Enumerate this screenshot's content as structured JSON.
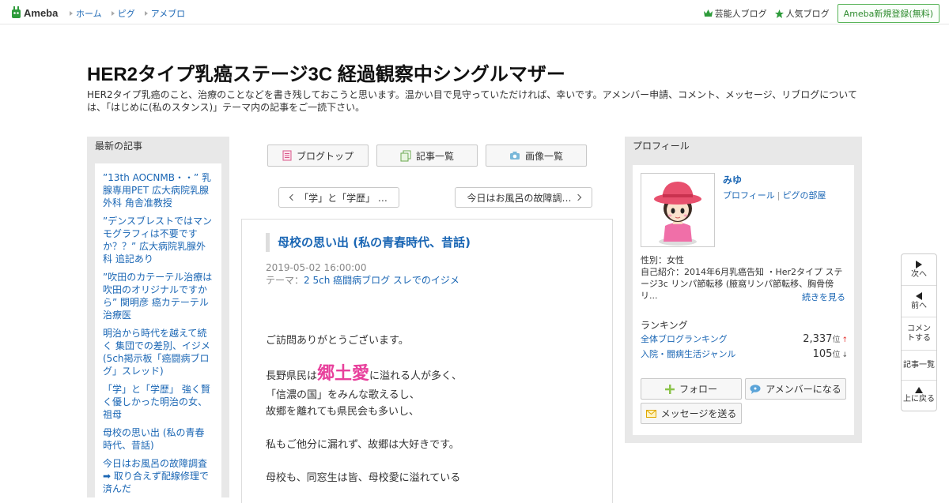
{
  "header": {
    "logo_text": "Ameba",
    "nav": [
      "ホーム",
      "ピグ",
      "アメブロ"
    ],
    "celebrity_blog": "芸能人ブログ",
    "popular_blog": "人気ブログ",
    "signup": "Ameba新規登録(無料)"
  },
  "blog": {
    "title": "HER2タイプ乳癌ステージ3C 経過観察中シングルマザー",
    "description": "HER2タイプ乳癌のこと、治療のことなどを書き残しておこうと思います。温かい目で見守っていただければ、幸いです。アメンバー申請、コメント、メッセージ、リブログについては、「はじめに(私のスタンス)」テーマ内の記事をご一読下さい。"
  },
  "left_sidebar": {
    "heading": "最新の記事",
    "recent_posts": [
      "”13th AOCNMB・・” 乳腺専用PET 広大病院乳腺外科 角舎准教授",
      "”デンスブレストではマンモグラフィは不要ですか？？” 広大病院乳腺外科 追記あり",
      "”吹田のカテーテル治療は吹田のオリジナルですから” 関明彦 癌カテーテル治療医",
      "明治から時代を越えて続く 集団での差別、イジメ (5ch掲示板「癌闘病ブログ」スレッド)",
      "「学」と「学歴」 強く賢く優しかった明治の女、祖母",
      "母校の思い出 (私の青春時代、昔話)",
      "今日はお風呂の故障調査 ➡ 取り合えず配線修理で済んだ"
    ]
  },
  "toolbar": {
    "blog_top": "ブログトップ",
    "post_list": "記事一覧",
    "image_list": "画像一覧"
  },
  "pager": {
    "prev": "「学」と「学歴」 …",
    "next": "今日はお風呂の故障調…"
  },
  "article": {
    "title": "母校の思い出 (私の青春時代、昔話)",
    "date": "2019-05-02 16:00:00",
    "theme_label": "テーマ：",
    "theme": "2 5ch 癌闘病ブログ スレでのイジメ",
    "p1": "ご訪問ありがとうございます。",
    "p2_before": "長野県民は",
    "p2_emph": "郷土愛",
    "p2_after": "に溢れる人が多く、",
    "p3": "「信濃の国」をみんな歌えるし、",
    "p4": "故郷を離れても県民会も多いし、",
    "p5": "私もご他分に漏れず、故郷は大好きです。",
    "p6": "母校も、同窓生は皆、母校愛に溢れている"
  },
  "profile": {
    "heading": "プロフィール",
    "name": "みゆ",
    "link_profile": "プロフィール",
    "link_pig": "ピグの部屋",
    "gender": "性別：女性",
    "intro": "自己紹介：2014年6月乳癌告知 ・Her2タイプ ステージ3c リンパ節転移 (腋窩リンパ節転移、胸骨傍リ...",
    "more": "続きを見る",
    "ranking_heading": "ランキング",
    "ranks": [
      {
        "label": "全体ブログランキング",
        "value": "2,337",
        "unit": "位",
        "trend": "↑"
      },
      {
        "label": "入院・闘病生活ジャンル",
        "value": "105",
        "unit": "位",
        "trend": "↓"
      }
    ],
    "follow": "フォロー",
    "amember": "アメンバーになる",
    "message": "メッセージを送る"
  },
  "floatnav": {
    "next": "次へ",
    "prev": "前へ",
    "comment": "コメントする",
    "list": "記事一覧",
    "top": "上に戻る"
  },
  "colors": {
    "link": "#1a66b4",
    "emphasis_pink": "#e8409c",
    "ameba_green": "#2e8b2e",
    "sidebar_gray": "#e8e8e8"
  }
}
